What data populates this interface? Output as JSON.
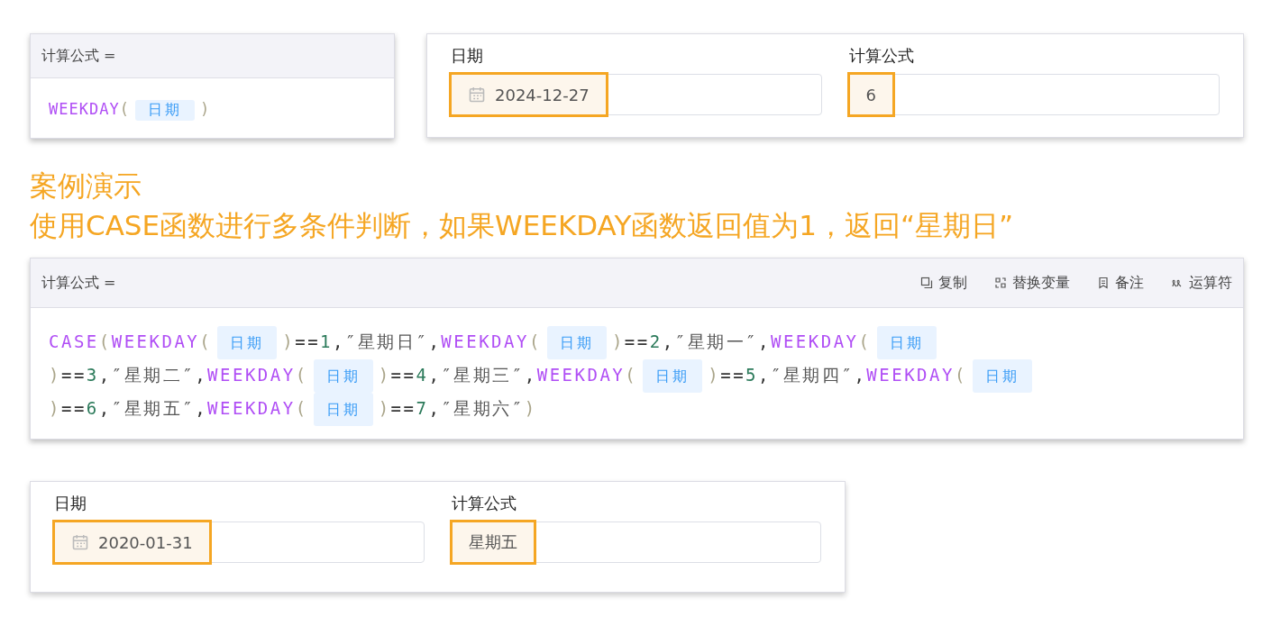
{
  "example_formula": {
    "header": "计算公式 =",
    "tokens": [
      {
        "kind": "func",
        "text": "WEEKDAY"
      },
      {
        "kind": "paren",
        "text": "("
      },
      {
        "kind": "field",
        "text": "日期"
      },
      {
        "kind": "paren",
        "text": ")"
      }
    ]
  },
  "example_form": {
    "fields": [
      {
        "label": "日期",
        "kind": "date",
        "value": "2024-12-27",
        "highlighted": true
      },
      {
        "label": "计算公式",
        "kind": "text",
        "value": "6",
        "highlighted": true
      }
    ]
  },
  "heading": {
    "title": "案例演示",
    "description": "使用CASE函数进行多条件判断，如果WEEKDAY函数返回值为1，返回“星期日”"
  },
  "case_formula": {
    "header": "计算公式 =",
    "actions": [
      {
        "kind": "copy",
        "label": "复制"
      },
      {
        "kind": "swap",
        "label": "替换变量"
      },
      {
        "kind": "note",
        "label": "备注"
      },
      {
        "kind": "operator",
        "label": "运算符"
      }
    ],
    "tokens": [
      {
        "kind": "func",
        "text": "CASE"
      },
      {
        "kind": "paren",
        "text": "("
      },
      {
        "kind": "func",
        "text": "WEEKDAY"
      },
      {
        "kind": "paren",
        "text": "("
      },
      {
        "kind": "field",
        "text": "日期"
      },
      {
        "kind": "paren",
        "text": ")"
      },
      {
        "kind": "op",
        "text": "=="
      },
      {
        "kind": "num",
        "text": "1"
      },
      {
        "kind": "op",
        "text": ","
      },
      {
        "kind": "str",
        "text": "″星期日″"
      },
      {
        "kind": "op",
        "text": ","
      },
      {
        "kind": "func",
        "text": "WEEKDAY"
      },
      {
        "kind": "paren",
        "text": "("
      },
      {
        "kind": "field",
        "text": "日期"
      },
      {
        "kind": "paren",
        "text": ")"
      },
      {
        "kind": "op",
        "text": "=="
      },
      {
        "kind": "num",
        "text": "2"
      },
      {
        "kind": "op",
        "text": ","
      },
      {
        "kind": "str",
        "text": "″星期一″"
      },
      {
        "kind": "op",
        "text": ","
      },
      {
        "kind": "func",
        "text": "WEEKDAY"
      },
      {
        "kind": "paren",
        "text": "("
      },
      {
        "kind": "field",
        "text": "日期"
      },
      {
        "kind": "paren",
        "text": ")"
      },
      {
        "kind": "op",
        "text": "=="
      },
      {
        "kind": "num",
        "text": "3"
      },
      {
        "kind": "op",
        "text": ","
      },
      {
        "kind": "str",
        "text": "″星期二″"
      },
      {
        "kind": "op",
        "text": ","
      },
      {
        "kind": "func",
        "text": "WEEKDAY"
      },
      {
        "kind": "paren",
        "text": "("
      },
      {
        "kind": "field",
        "text": "日期"
      },
      {
        "kind": "paren",
        "text": ")"
      },
      {
        "kind": "op",
        "text": "=="
      },
      {
        "kind": "num",
        "text": "4"
      },
      {
        "kind": "op",
        "text": ","
      },
      {
        "kind": "str",
        "text": "″星期三″"
      },
      {
        "kind": "op",
        "text": ","
      },
      {
        "kind": "func",
        "text": "WEEKDAY"
      },
      {
        "kind": "paren",
        "text": "("
      },
      {
        "kind": "field",
        "text": "日期"
      },
      {
        "kind": "paren",
        "text": ")"
      },
      {
        "kind": "op",
        "text": "=="
      },
      {
        "kind": "num",
        "text": "5"
      },
      {
        "kind": "op",
        "text": ","
      },
      {
        "kind": "str",
        "text": "″星期四″"
      },
      {
        "kind": "op",
        "text": ","
      },
      {
        "kind": "func",
        "text": "WEEKDAY"
      },
      {
        "kind": "paren",
        "text": "("
      },
      {
        "kind": "field",
        "text": "日期"
      },
      {
        "kind": "paren",
        "text": ")"
      },
      {
        "kind": "op",
        "text": "=="
      },
      {
        "kind": "num",
        "text": "6"
      },
      {
        "kind": "op",
        "text": ","
      },
      {
        "kind": "str",
        "text": "″星期五″"
      },
      {
        "kind": "op",
        "text": ","
      },
      {
        "kind": "func",
        "text": "WEEKDAY"
      },
      {
        "kind": "paren",
        "text": "("
      },
      {
        "kind": "field",
        "text": "日期"
      },
      {
        "kind": "paren",
        "text": ")"
      },
      {
        "kind": "op",
        "text": "=="
      },
      {
        "kind": "num",
        "text": "7"
      },
      {
        "kind": "op",
        "text": ","
      },
      {
        "kind": "str",
        "text": "″星期六″"
      },
      {
        "kind": "paren",
        "text": ")"
      }
    ]
  },
  "case_form": {
    "fields": [
      {
        "label": "日期",
        "kind": "date",
        "value": "2020-01-31",
        "highlighted": true
      },
      {
        "label": "计算公式",
        "kind": "text",
        "value": "星期五",
        "highlighted": true
      }
    ]
  }
}
